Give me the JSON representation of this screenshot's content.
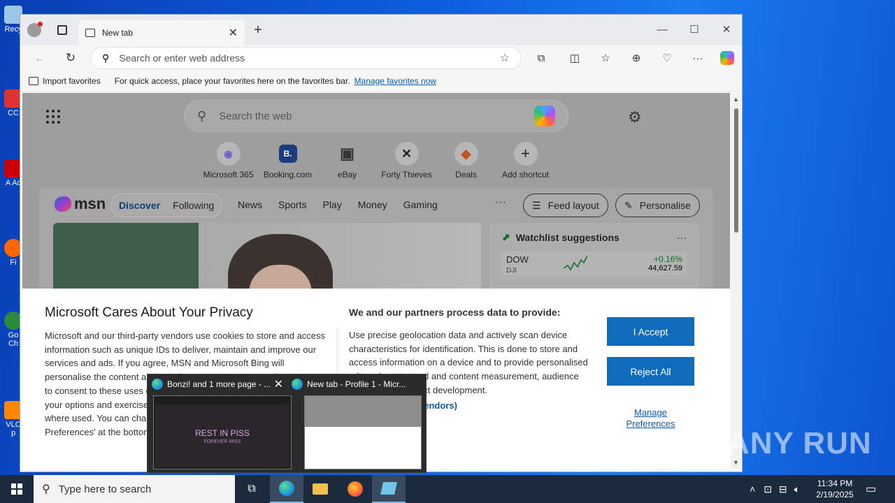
{
  "desktop": {
    "icons": [
      {
        "label": "Recy"
      },
      {
        "label": "CC"
      },
      {
        "label": "A\nAc"
      },
      {
        "label": "Fi"
      },
      {
        "label": "Go\nCh"
      },
      {
        "label": "VLC\np"
      }
    ]
  },
  "browser": {
    "tab": {
      "label": "New tab"
    },
    "address": {
      "placeholder": "Search or enter web address"
    },
    "favorites_bar": {
      "import_label": "Import favorites",
      "message": "For quick access, place your favorites here on the favorites bar.",
      "link": "Manage favorites now"
    }
  },
  "ntp": {
    "search_placeholder": "Search the web",
    "shortcuts": [
      {
        "label": "Microsoft 365",
        "icon": "m365-icon",
        "glyph": "◉"
      },
      {
        "label": "Booking.com",
        "icon": "booking-icon",
        "glyph": "B."
      },
      {
        "label": "eBay",
        "icon": "ebay-icon",
        "glyph": "▣"
      },
      {
        "label": "Forty Thieves",
        "icon": "swords-icon",
        "glyph": "✕"
      },
      {
        "label": "Deals",
        "icon": "tag-icon",
        "glyph": "◆"
      },
      {
        "label": "Add shortcut",
        "icon": "plus-icon",
        "glyph": "+"
      }
    ],
    "msn": {
      "logo": "msn",
      "discover": "Discover",
      "following": "Following",
      "nav": [
        "News",
        "Sports",
        "Play",
        "Money",
        "Gaming"
      ],
      "more": "···",
      "feed_layout": "Feed layout",
      "personalise": "Personalise",
      "watchlist": {
        "title": "Watchlist suggestions",
        "more": "···",
        "ticker": "DOW",
        "exchange": "DJI",
        "change": "+0.16%",
        "price": "44,627.59"
      }
    }
  },
  "privacy": {
    "title": "Microsoft Cares About Your Privacy",
    "left_text": "Microsoft and our third-party vendors use cookies to store and access information such as unique IDs to deliver, maintain and improve our services and ads. If you agree, MSN and Microsoft Bing will personalise the content and ads that you see. You can select 'I Accept' to consent to these uses or click on 'Manage preferences' to review your options and exercise your right to object to Legitimate Interest where used. You can change your selection under 'Manage Preferences' at the bottom of this page. Number of Partners (vendors):",
    "mid_title": "We and our partners process data to provide:",
    "mid_text": "Use precise geolocation data and actively scan device characteristics for identification. This is done to store and access information on a device and to provide personalised ads and content, ad and content measurement, audience insights and product development.",
    "vendors_link": "vendors)",
    "accept": "I Accept",
    "reject": "Reject All",
    "manage": "Manage Preferences"
  },
  "thumbnails": [
    {
      "title": "Bonzi! and 1 more page - ...",
      "preview_text": "REST IN PISS",
      "preview_sub": "FOREVER MISS"
    },
    {
      "title": "New tab - Profile 1 - Micr..."
    }
  ],
  "taskbar": {
    "search_placeholder": "Type here to search",
    "time": "11:34 PM",
    "date": "2/19/2025"
  },
  "watermark": "ANY RUN"
}
